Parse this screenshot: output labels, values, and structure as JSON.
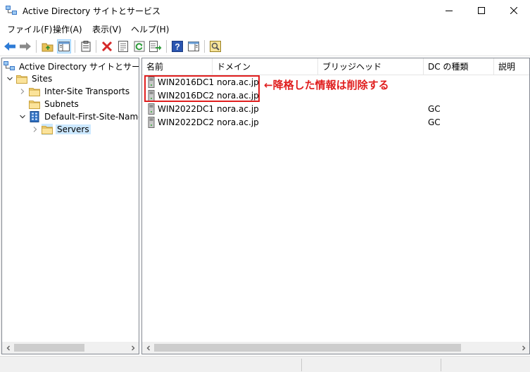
{
  "window": {
    "title": "Active Directory サイトとサービス",
    "app_icon": "ad-sites-icon",
    "controls": [
      "minimize-icon",
      "maximize-icon",
      "close-icon"
    ]
  },
  "menu": {
    "items": [
      {
        "label": "ファイル(F)"
      },
      {
        "label": "操作(A)"
      },
      {
        "label": "表示(V)"
      },
      {
        "label": "ヘルプ(H)"
      }
    ]
  },
  "toolbar": {
    "icons": [
      "back-arrow-icon",
      "forward-arrow-icon",
      "up-folder-icon",
      "show-hide-tree-icon",
      "clipboard-icon",
      "delete-icon",
      "properties-icon",
      "refresh-icon",
      "export-list-icon",
      "help-icon",
      "show-action-pane-icon",
      "find-icon"
    ]
  },
  "tree": {
    "root": "Active Directory サイトとサービス [W",
    "sites": "Sites",
    "inter_site": "Inter-Site Transports",
    "subnets": "Subnets",
    "default_site": "Default-First-Site-Name",
    "servers": "Servers"
  },
  "list": {
    "columns": [
      "名前",
      "ドメイン",
      "ブリッジヘッド",
      "DC の種類",
      "説明"
    ],
    "rows": [
      {
        "name": "WIN2016DC1",
        "domain": "nora.ac.jp",
        "bridgehead": "",
        "dc_type": "",
        "desc": ""
      },
      {
        "name": "WIN2016DC2",
        "domain": "nora.ac.jp",
        "bridgehead": "",
        "dc_type": "",
        "desc": ""
      },
      {
        "name": "WIN2022DC1",
        "domain": "nora.ac.jp",
        "bridgehead": "",
        "dc_type": "GC",
        "desc": ""
      },
      {
        "name": "WIN2022DC2",
        "domain": "nora.ac.jp",
        "bridgehead": "",
        "dc_type": "GC",
        "desc": ""
      }
    ]
  },
  "annotation": {
    "text": "←降格した情報は削除する",
    "color": "#e01e1e"
  },
  "colors": {
    "selection": "#cce8ff",
    "annotation": "#e01e1e"
  }
}
